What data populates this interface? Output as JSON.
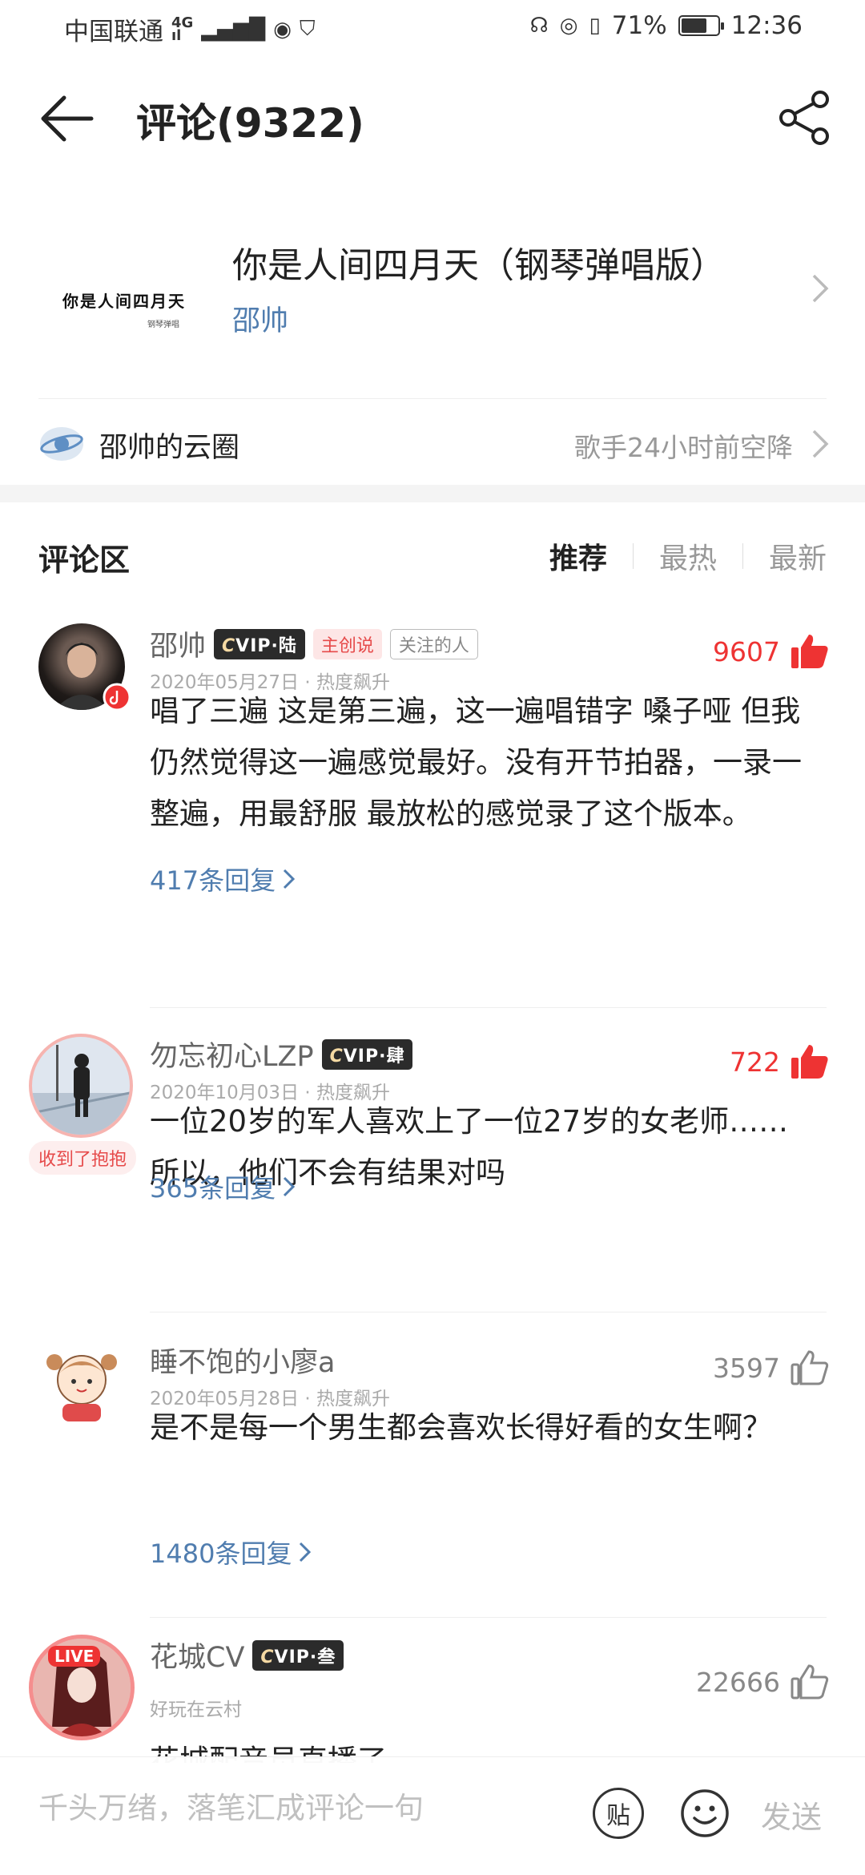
{
  "status_bar": {
    "carrier": "中国联通",
    "network": "4G",
    "battery": "71%",
    "battery_level": 0.71,
    "time": "12:36"
  },
  "header": {
    "title": "评论(9322)",
    "back_icon": "arrow-left-icon",
    "share_icon": "share-icon"
  },
  "song": {
    "cover_text": "你是人间四月天",
    "cover_subtext": "钢琴弹唱",
    "name": "你是人间四月天（钢琴弹唱版）",
    "artist": "邵帅"
  },
  "circle": {
    "label": "邵帅的云圈",
    "status": "歌手24小时前空降"
  },
  "comments_section": {
    "title": "评论区",
    "sort_options": [
      "推荐",
      "最热",
      "最新"
    ],
    "active_sort": "推荐"
  },
  "comments": [
    {
      "user": "邵帅",
      "vip": "VIP·陆",
      "tags": [
        "主创说",
        "关注的人"
      ],
      "date": "2020年05月27日 · 热度飙升",
      "likes": "9607",
      "liked": true,
      "content": "唱了三遍 这是第三遍，这一遍唱错字 嗓子哑 但我仍然觉得这一遍感觉最好。没有开节拍器，一录一整遍，用最舒服 最放松的感觉录了这个版本。",
      "replies": "417条回复"
    },
    {
      "user": "勿忘初心LZP",
      "vip": "VIP·肆",
      "badge": "收到了抱抱",
      "date": "2020年10月03日 · 热度飙升",
      "likes": "722",
      "liked": true,
      "content": "一位20岁的军人喜欢上了一位27岁的女老师……所以，他们不会有结果对吗",
      "replies": "365条回复"
    },
    {
      "user": "睡不饱的小廖a",
      "date": "2020年05月28日 · 热度飙升",
      "likes": "3597",
      "liked": false,
      "content": "是不是每一个男生都会喜欢长得好看的女生啊？",
      "replies": "1480条回复"
    },
    {
      "user": "花城CV",
      "vip": "VIP·叁",
      "live": "LIVE",
      "date": "好玩在云村",
      "likes": "22666",
      "liked": false,
      "content": "花城配音员直播了"
    }
  ],
  "input_bar": {
    "placeholder": "千头万绪，落笔汇成评论一句",
    "tie_label": "贴",
    "send_label": "发送"
  }
}
